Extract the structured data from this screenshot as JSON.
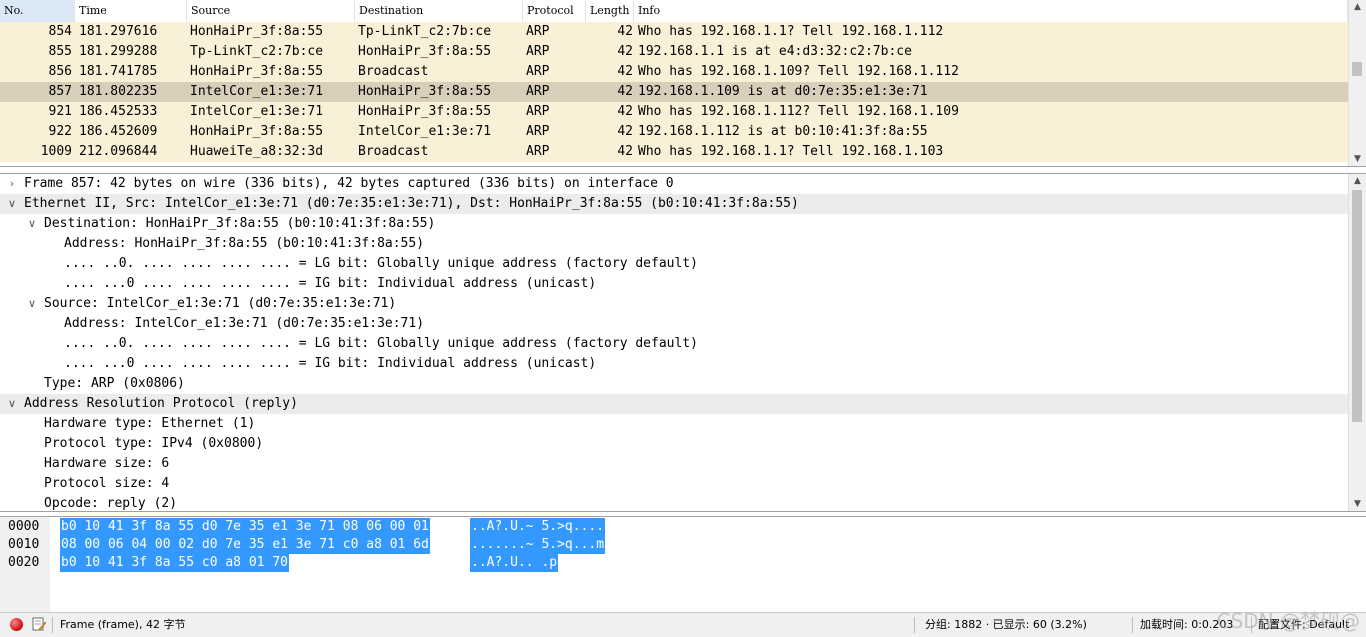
{
  "packet_list": {
    "columns": {
      "no": "No.",
      "time": "Time",
      "source": "Source",
      "destination": "Destination",
      "protocol": "Protocol",
      "length": "Length",
      "info": "Info"
    },
    "rows": [
      {
        "no": "854",
        "time": "181.297616",
        "source": "HonHaiPr_3f:8a:55",
        "destination": "Tp-LinkT_c2:7b:ce",
        "protocol": "ARP",
        "length": "42",
        "info": "Who has 192.168.1.1? Tell 192.168.1.112"
      },
      {
        "no": "855",
        "time": "181.299288",
        "source": "Tp-LinkT_c2:7b:ce",
        "destination": "HonHaiPr_3f:8a:55",
        "protocol": "ARP",
        "length": "42",
        "info": "192.168.1.1 is at e4:d3:32:c2:7b:ce"
      },
      {
        "no": "856",
        "time": "181.741785",
        "source": "HonHaiPr_3f:8a:55",
        "destination": "Broadcast",
        "protocol": "ARP",
        "length": "42",
        "info": "Who has 192.168.1.109? Tell 192.168.1.112"
      },
      {
        "no": "857",
        "time": "181.802235",
        "source": "IntelCor_e1:3e:71",
        "destination": "HonHaiPr_3f:8a:55",
        "protocol": "ARP",
        "length": "42",
        "info": "192.168.1.109 is at d0:7e:35:e1:3e:71"
      },
      {
        "no": "921",
        "time": "186.452533",
        "source": "IntelCor_e1:3e:71",
        "destination": "HonHaiPr_3f:8a:55",
        "protocol": "ARP",
        "length": "42",
        "info": "Who has 192.168.1.112? Tell 192.168.1.109"
      },
      {
        "no": "922",
        "time": "186.452609",
        "source": "HonHaiPr_3f:8a:55",
        "destination": "IntelCor_e1:3e:71",
        "protocol": "ARP",
        "length": "42",
        "info": "192.168.1.112 is at b0:10:41:3f:8a:55"
      },
      {
        "no": "1009",
        "time": "212.096844",
        "source": "HuaweiTe_a8:32:3d",
        "destination": "Broadcast",
        "protocol": "ARP",
        "length": "42",
        "info": "Who has 192.168.1.1? Tell 192.168.1.103"
      }
    ],
    "selected_no": "857"
  },
  "details": {
    "lines": [
      {
        "text": "Frame 857: 42 bytes on wire (336 bits), 42 bytes captured (336 bits) on interface 0",
        "toggle": "collapsed"
      },
      {
        "text": "Ethernet II, Src: IntelCor_e1:3e:71 (d0:7e:35:e1:3e:71), Dst: HonHaiPr_3f:8a:55 (b0:10:41:3f:8a:55)",
        "toggle": "expanded"
      },
      {
        "text": "Destination: HonHaiPr_3f:8a:55 (b0:10:41:3f:8a:55)",
        "toggle": "expanded"
      },
      {
        "text": "Address: HonHaiPr_3f:8a:55 (b0:10:41:3f:8a:55)",
        "toggle": "none"
      },
      {
        "text": ".... ..0. .... .... .... .... = LG bit: Globally unique address (factory default)",
        "toggle": "none"
      },
      {
        "text": ".... ...0 .... .... .... .... = IG bit: Individual address (unicast)",
        "toggle": "none"
      },
      {
        "text": "Source: IntelCor_e1:3e:71 (d0:7e:35:e1:3e:71)",
        "toggle": "expanded"
      },
      {
        "text": "Address: IntelCor_e1:3e:71 (d0:7e:35:e1:3e:71)",
        "toggle": "none"
      },
      {
        "text": ".... ..0. .... .... .... .... = LG bit: Globally unique address (factory default)",
        "toggle": "none"
      },
      {
        "text": ".... ...0 .... .... .... .... = IG bit: Individual address (unicast)",
        "toggle": "none"
      },
      {
        "text": "Type: ARP (0x0806)",
        "toggle": "none"
      },
      {
        "text": "Address Resolution Protocol (reply)",
        "toggle": "expanded"
      },
      {
        "text": "Hardware type: Ethernet (1)",
        "toggle": "none"
      },
      {
        "text": "Protocol type: IPv4 (0x0800)",
        "toggle": "none"
      },
      {
        "text": "Hardware size: 6",
        "toggle": "none"
      },
      {
        "text": "Protocol size: 4",
        "toggle": "none"
      },
      {
        "text": "Opcode: reply (2)",
        "toggle": "none"
      }
    ]
  },
  "bytes": {
    "rows": [
      {
        "offset": "0000",
        "hex": "b0 10 41 3f 8a 55 d0 7e  35 e1 3e 71 08 06 00 01",
        "ascii": "..A?.U.~ 5.>q...."
      },
      {
        "offset": "0010",
        "hex": "08 00 06 04 00 02 d0 7e  35 e1 3e 71 c0 a8 01 6d",
        "ascii": ".......~ 5.>q...m"
      },
      {
        "offset": "0020",
        "hex": "b0 10 41 3f 8a 55 c0 a8  01 70",
        "ascii": "..A?.U.. .p"
      }
    ]
  },
  "statusbar": {
    "field_info": "Frame (frame), 42 字节",
    "packets": "分组: 1882 · 已显示: 60 (3.2%)",
    "load_time": "加载时间: 0:0.203",
    "profile": "配置文件: Default",
    "watermark": "CSDN @梦砚@"
  }
}
